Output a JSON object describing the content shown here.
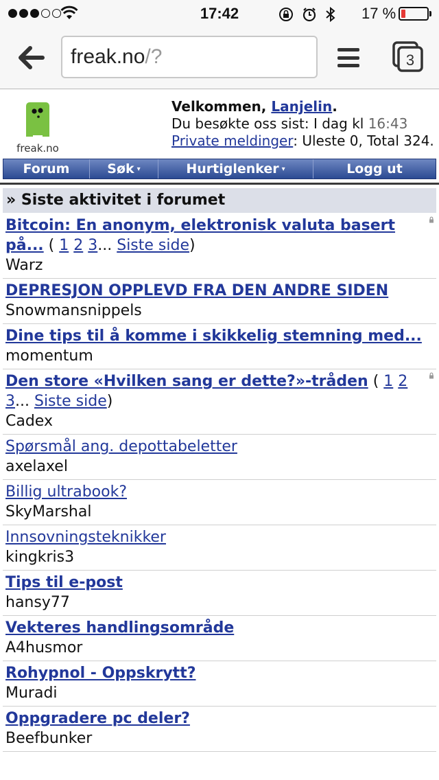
{
  "status_bar": {
    "time": "17:42",
    "battery": "17 %",
    "battery_level": 0.17,
    "signal_dots_filled": 3,
    "signal_dots_total": 5,
    "icons": [
      "wifi-icon",
      "orientation-lock-icon",
      "alarm-icon",
      "bluetooth-icon",
      "battery-icon"
    ]
  },
  "browser": {
    "url_host": "freak.no",
    "url_path": "/?",
    "tab_count": "3"
  },
  "header": {
    "logo_text": "freak.no",
    "welcome_prefix": "Velkommen, ",
    "username": "Lanjelin",
    "welcome_suffix": ".",
    "last_visit_prefix": "Du besøkte oss sist: I dag kl ",
    "last_visit_time": "16:43",
    "pm_link": "Private meldinger",
    "pm_status": ": Uleste 0, Total 324."
  },
  "nav": [
    {
      "label": "Forum",
      "dropdown": false
    },
    {
      "label": "Søk",
      "dropdown": true
    },
    {
      "label": "Hurtiglenker",
      "dropdown": true
    },
    {
      "label": "Logg ut",
      "dropdown": false
    }
  ],
  "section_title": "» Siste aktivitet i forumet",
  "threads": [
    {
      "title": "Bitcoin: En anonym, elektronisk valuta basert på...",
      "bold": true,
      "pages": [
        "1",
        "2",
        "3"
      ],
      "last_page": "Siste side",
      "author": "Warz",
      "locked": true
    },
    {
      "title": "DEPRESJON OPPLEVD FRA DEN ANDRE SIDEN",
      "bold": true,
      "pages": [],
      "last_page": "",
      "author": "Snowmansnippels",
      "locked": false
    },
    {
      "title": "Dine tips til å komme i skikkelig stemning med...",
      "bold": true,
      "pages": [],
      "last_page": "",
      "author": "momentum",
      "locked": false
    },
    {
      "title": "Den store «Hvilken sang er dette?»-tråden",
      "bold": true,
      "pages": [
        "1",
        "2",
        "3"
      ],
      "last_page": "Siste side",
      "author": "Cadex",
      "locked": true
    },
    {
      "title": "Spørsmål ang. depottabeletter",
      "bold": false,
      "pages": [],
      "last_page": "",
      "author": "axelaxel",
      "locked": false
    },
    {
      "title": "Billig ultrabook?",
      "bold": false,
      "pages": [],
      "last_page": "",
      "author": "SkyMarshal",
      "locked": false
    },
    {
      "title": "Innsovningsteknikker",
      "bold": false,
      "pages": [],
      "last_page": "",
      "author": "kingkris3",
      "locked": false
    },
    {
      "title": "Tips til e-post",
      "bold": true,
      "pages": [],
      "last_page": "",
      "author": "hansy77",
      "locked": false
    },
    {
      "title": "Vekteres handlingsområde",
      "bold": true,
      "pages": [],
      "last_page": "",
      "author": "A4husmor",
      "locked": false
    },
    {
      "title": "Rohypnol - Oppskrytt?",
      "bold": true,
      "pages": [],
      "last_page": "",
      "author": "Muradi",
      "locked": false
    },
    {
      "title": "Oppgradere pc deler?",
      "bold": true,
      "pages": [],
      "last_page": "",
      "author": "Beefbunker",
      "locked": false
    }
  ]
}
